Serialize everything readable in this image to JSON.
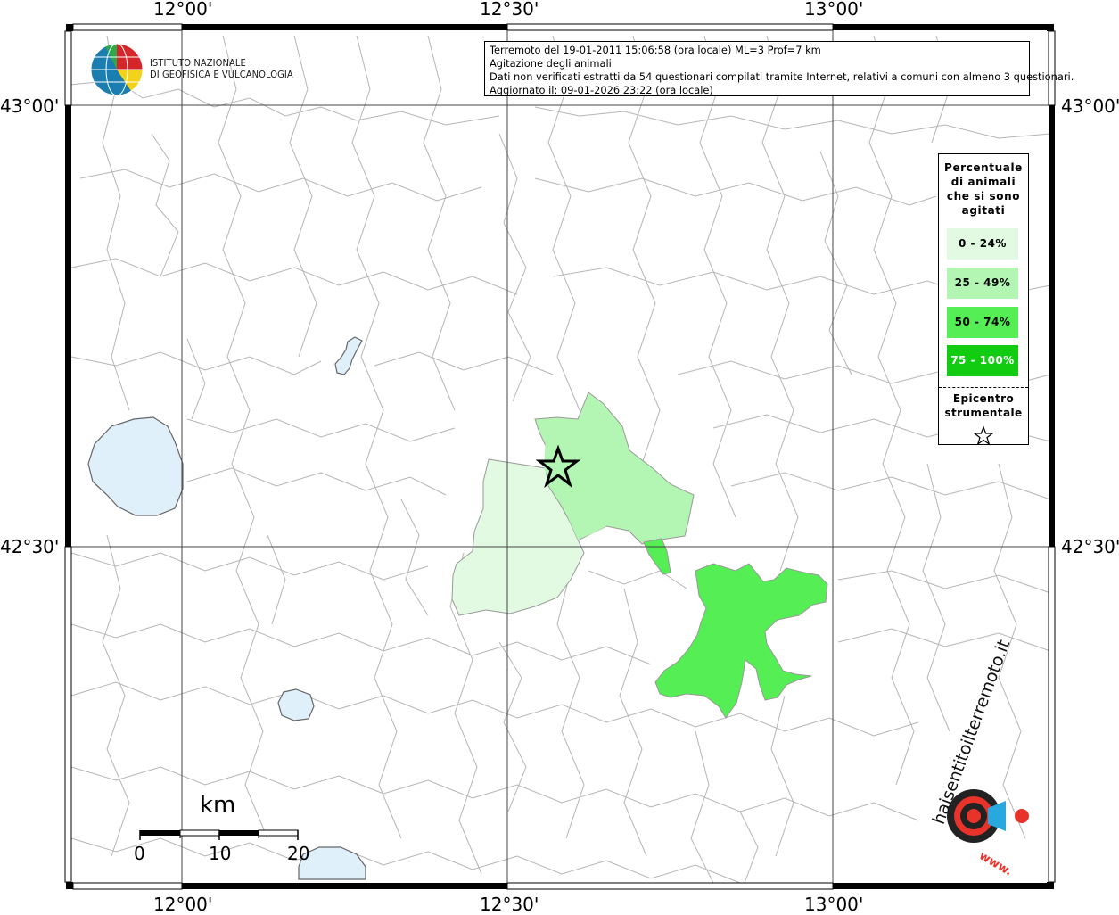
{
  "map": {
    "lon_labels": [
      "12°00'",
      "12°30'",
      "13°00'"
    ],
    "lat_labels": [
      "43°00'",
      "42°30'"
    ]
  },
  "header": {
    "institute_line1": "ISTITUTO NAZIONALE",
    "institute_line2": "DI GEOFISICA E VULCANOLOGIA"
  },
  "info": {
    "line1": "Terremoto del 19-01-2011 15:06:58 (ora locale) ML=3 Prof=7 km",
    "line2": "Agitazione degli animali",
    "line3": "Dati non verificati estratti da 54 questionari compilati tramite Internet, relativi a comuni con almeno 3 questionari.",
    "line4": "Aggiornato il: 09-01-2026 23:22 (ora locale)"
  },
  "legend": {
    "title_line1": "Percentuale",
    "title_line2": "di animali",
    "title_line3": "che si sono",
    "title_line4": "agitati",
    "classes": [
      {
        "label": "0 - 24%",
        "color": "#e2fae2"
      },
      {
        "label": "25 - 49%",
        "color": "#b3f5b3"
      },
      {
        "label": "50 - 74%",
        "color": "#55ee55"
      },
      {
        "label": "75 - 100%",
        "color": "#11cc11"
      }
    ],
    "epicenter_line1": "Epicentro",
    "epicenter_line2": "strumentale"
  },
  "scalebar": {
    "unit": "km",
    "ticks": [
      "0",
      "10",
      "20"
    ]
  },
  "colors": {
    "water": "#dff0fb",
    "border": "#b5b5b5",
    "class_0_24": "#e2fae2",
    "class_25_49": "#b3f5b3",
    "class_50_74": "#55ee55"
  },
  "watermark": {
    "text": "haisentitoilterremoto.it",
    "url": "www.",
    "icon": "speaker-target-icon"
  },
  "epicenter_icon": "star-icon"
}
